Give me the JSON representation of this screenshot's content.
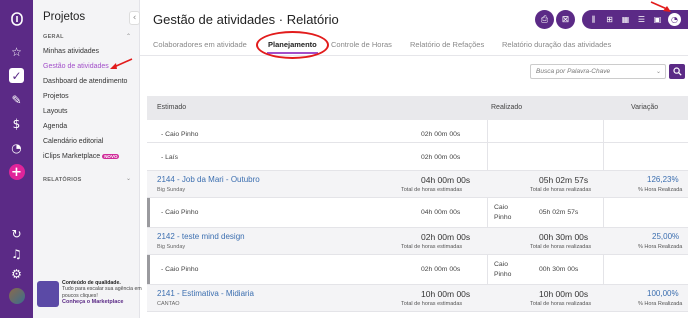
{
  "app": {
    "title": "Projetos"
  },
  "sidebar": {
    "sections": [
      {
        "label": "GERAL"
      },
      {
        "label": "RELATÓRIOS"
      }
    ],
    "items": [
      {
        "label": "Minhas atividades"
      },
      {
        "label": "Gestão de atividades"
      },
      {
        "label": "Dashboard de atendimento"
      },
      {
        "label": "Projetos"
      },
      {
        "label": "Layouts"
      },
      {
        "label": "Agenda"
      },
      {
        "label": "Calendário editorial"
      },
      {
        "label": "iClips Marketplace",
        "badge": "NOVO"
      }
    ],
    "promo": {
      "title": "Conteúdo de qualidade.",
      "text": "Tudo para escalar sua agência em poucos cliques!",
      "link": "Conheça o Marketplace"
    }
  },
  "rail": {
    "icons": [
      "logo-icon",
      "star-icon",
      "clipboard-icon",
      "edit-icon",
      "dollar-icon",
      "clock-icon",
      "plus-icon",
      "history-icon",
      "bell-icon",
      "gear-icon",
      "avatar"
    ]
  },
  "header": {
    "title": "Gestão de atividades · Relatório"
  },
  "tabs": [
    {
      "label": "Colaboradores em atividade"
    },
    {
      "label": "Planejamento"
    },
    {
      "label": "Controle de Horas"
    },
    {
      "label": "Relatório de Refações"
    },
    {
      "label": "Relatório duração das atividades"
    }
  ],
  "search": {
    "placeholder": "Busca por Palavra-Chave"
  },
  "table": {
    "headers": {
      "estimado": "Estimado",
      "realizado": "Realizado",
      "variacao": "Variação"
    },
    "rows": [
      {
        "type": "person",
        "name": "- Caio Pinho",
        "est": "02h 00m 00s"
      },
      {
        "type": "person",
        "name": "- Laís",
        "est": "02h 00m 00s"
      },
      {
        "type": "task",
        "title": "2144 - Job da Mari - Outubro",
        "client": "Big Sunday",
        "est": "04h 00m 00s",
        "est_label": "Total de horas estimadas",
        "real": "05h 02m 57s",
        "real_label": "Total de horas realizadas",
        "pct": "126,23%",
        "pct_label": "% Hora Realizada"
      },
      {
        "type": "person",
        "name": "- Caio Pinho",
        "est": "04h 00m 00s",
        "who_line1": "Caio",
        "who_line2": "Pinho",
        "real": "05h 02m 57s"
      },
      {
        "type": "task",
        "title": "2142 - teste mind design",
        "client": "Big Sunday",
        "est": "02h 00m 00s",
        "est_label": "Total de horas estimadas",
        "real": "00h 30m 00s",
        "real_label": "Total de horas realizadas",
        "pct": "25,00%",
        "pct_label": "% Hora Realizada"
      },
      {
        "type": "person",
        "name": "- Caio Pinho",
        "est": "02h 00m 00s",
        "who_line1": "Caio",
        "who_line2": "Pinho",
        "real": "00h 30m 00s"
      },
      {
        "type": "task",
        "title": "2141 - Estimativa - Midiaria",
        "client": "CANTAO",
        "est": "10h 00m 00s",
        "est_label": "Total de horas estimadas",
        "real": "10h 00m 00s",
        "real_label": "Total de horas realizadas",
        "pct": "100,00%",
        "pct_label": "% Hora Realizada"
      }
    ]
  },
  "colors": {
    "primary": "#5b2a86",
    "accent": "#a24fc9",
    "link": "#3c6fb0",
    "annotation": "#e21c1c"
  }
}
